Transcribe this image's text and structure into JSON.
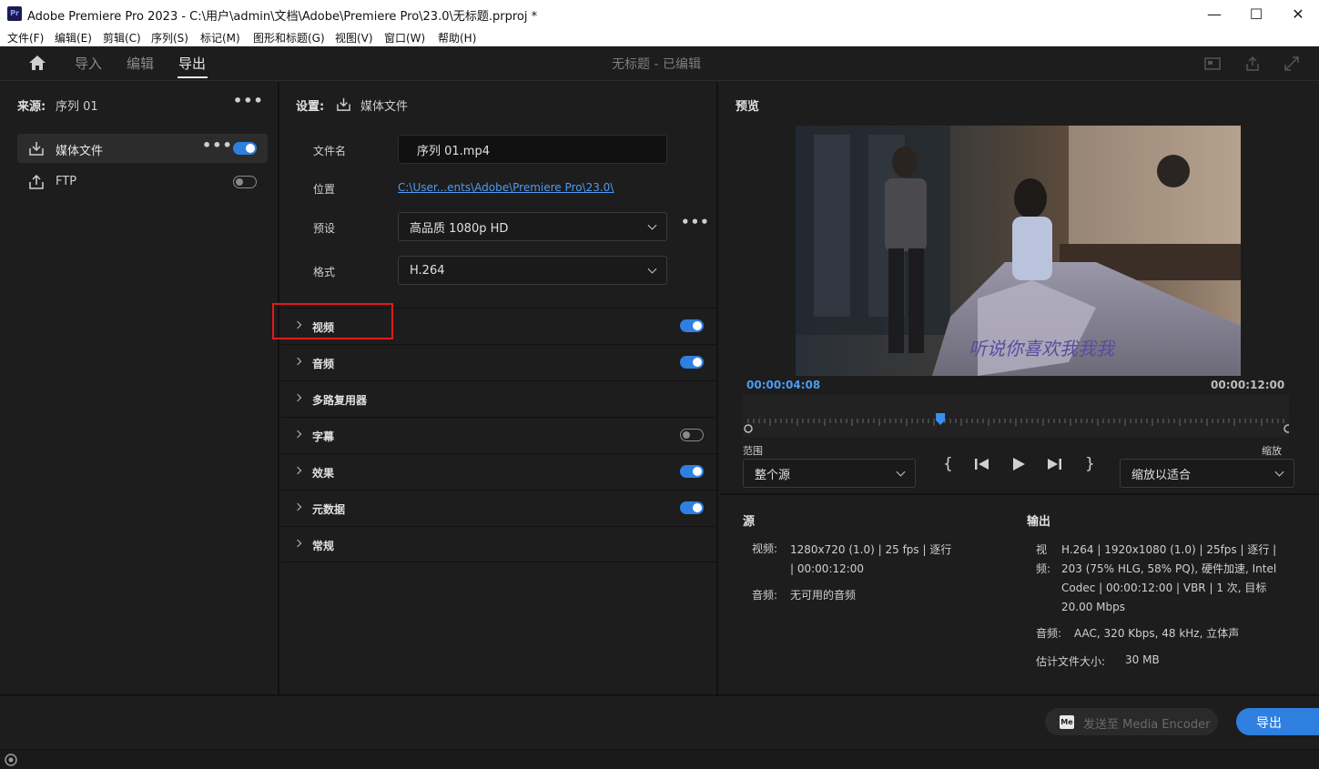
{
  "window": {
    "app_icon": "Pr",
    "title": "Adobe Premiere Pro 2023 - C:\\用户\\admin\\文档\\Adobe\\Premiere Pro\\23.0\\无标题.prproj *",
    "minimize": "—",
    "maximize": "☐",
    "close": "✕"
  },
  "menu": [
    "文件(F)",
    "编辑(E)",
    "剪辑(C)",
    "序列(S)",
    "标记(M)",
    "图形和标题(G)",
    "视图(V)",
    "窗口(W)",
    "帮助(H)"
  ],
  "header": {
    "tabs": [
      "导入",
      "编辑",
      "导出"
    ],
    "active_tab": "导出",
    "project_status": "无标题 - 已编辑"
  },
  "source_panel": {
    "label": "来源:",
    "sequence": "序列 01",
    "destinations": [
      {
        "label": "媒体文件",
        "enabled": true,
        "icon": "download-icon"
      },
      {
        "label": "FTP",
        "enabled": false,
        "icon": "upload-icon"
      }
    ]
  },
  "settings_panel": {
    "label": "设置:",
    "target": "媒体文件",
    "filename_label": "文件名",
    "filename_value": "序列 01.mp4",
    "location_label": "位置",
    "location_value": "C:\\User...ents\\Adobe\\Premiere Pro\\23.0\\",
    "preset_label": "预设",
    "preset_value": "高品质 1080p HD",
    "format_label": "格式",
    "format_value": "H.264",
    "sections": [
      {
        "label": "视频",
        "toggle": "on"
      },
      {
        "label": "音频",
        "toggle": "on"
      },
      {
        "label": "多路复用器",
        "toggle": "none"
      },
      {
        "label": "字幕",
        "toggle": "off"
      },
      {
        "label": "效果",
        "toggle": "on"
      },
      {
        "label": "元数据",
        "toggle": "on"
      },
      {
        "label": "常规",
        "toggle": "none"
      }
    ]
  },
  "preview": {
    "label": "预览",
    "subtitle_overlay": "听说你喜欢我我我",
    "current_time": "00:00:04:08",
    "duration": "00:00:12:00",
    "playhead_fraction": 0.356,
    "range_label": "范围",
    "range_value": "整个源",
    "zoom_label": "缩放",
    "zoom_value": "缩放以适合"
  },
  "summary": {
    "source_title": "源",
    "source_video_label": "视频:",
    "source_video_value": "1280x720 (1.0) | 25 fps | 逐行 | 00:00:12:00",
    "source_audio_label": "音频:",
    "source_audio_value": "无可用的音频",
    "output_title": "输出",
    "output_video_label": "视频:",
    "output_video_value": "H.264 | 1920x1080 (1.0) | 25fps | 逐行 | 203 (75% HLG, 58% PQ), 硬件加速, Intel Codec | 00:00:12:00 | VBR | 1 次, 目标 20.00 Mbps",
    "output_audio_label": "音频:",
    "output_audio_value": "AAC, 320 Kbps, 48 kHz, 立体声",
    "filesize_label": "估计文件大小:",
    "filesize_value": "30 MB"
  },
  "footer": {
    "send_to_me": "发送至 Media Encoder",
    "me_badge": "Me",
    "export_button": "导出"
  },
  "colors": {
    "accent": "#2f7fe0",
    "highlight_box": "#e21a1a",
    "link": "#4d9bf2"
  }
}
